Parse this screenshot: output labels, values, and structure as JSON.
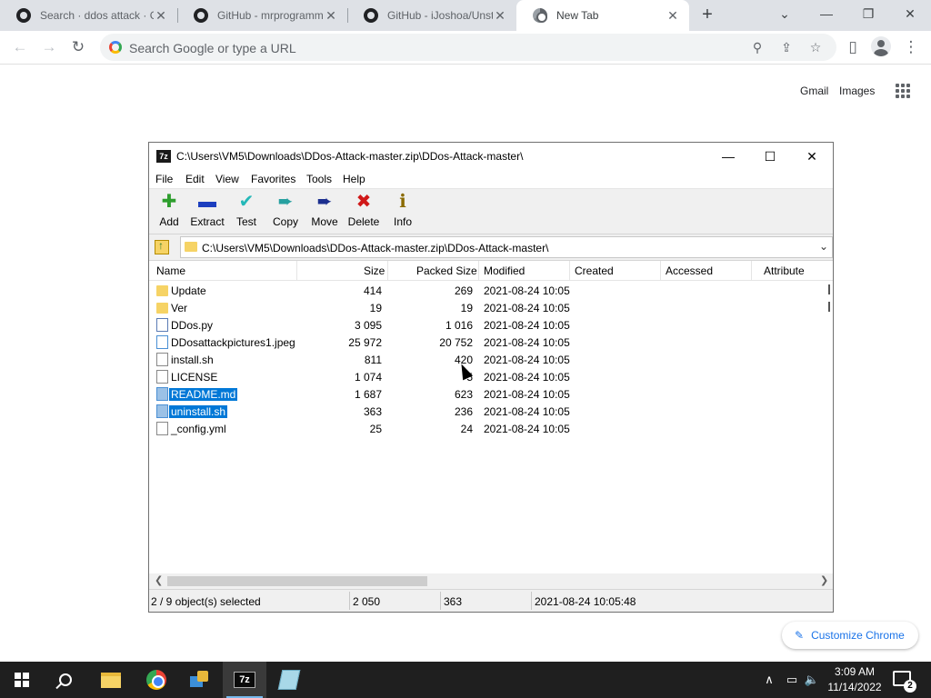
{
  "browser": {
    "tabs": [
      {
        "title": "Search · ddos attack · G",
        "icon": "github-icon"
      },
      {
        "title": "GitHub - mrprogramm",
        "icon": "github-icon"
      },
      {
        "title": "GitHub - iJoshoa/Unst",
        "icon": "github-icon"
      },
      {
        "title": "New Tab",
        "icon": "chrome-icon",
        "active": true
      }
    ],
    "new_tab": "+",
    "window_controls": {
      "dropdown": "⌄",
      "minimize": "—",
      "maximize": "❐",
      "close": "✕"
    },
    "toolbar": {
      "back": "←",
      "forward": "→",
      "reload": "↻"
    },
    "omnibox_placeholder": "Search Google or type a URL",
    "omnibox_icons": {
      "zoom": "⚲",
      "share": "⇪",
      "bookmark": "☆"
    },
    "side_panel": "▯",
    "menu": "⋮"
  },
  "ntp": {
    "gmail": "Gmail",
    "images": "Images",
    "customize": "Customize Chrome",
    "customize_icon": "✎"
  },
  "sevenzip": {
    "logo": "7z",
    "title": "C:\\Users\\VM5\\Downloads\\DDos-Attack-master.zip\\DDos-Attack-master\\",
    "controls": {
      "minimize": "—",
      "maximize": "☐",
      "close": "✕"
    },
    "menu": [
      "File",
      "Edit",
      "View",
      "Favorites",
      "Tools",
      "Help"
    ],
    "tools": [
      {
        "label": "Add",
        "glyph": "✚",
        "color": "#2e9e2e"
      },
      {
        "label": "Extract",
        "glyph": "▬",
        "color": "#1c3fbf"
      },
      {
        "label": "Test",
        "glyph": "✔",
        "color": "#24b8b8"
      },
      {
        "label": "Copy",
        "glyph": "➨",
        "color": "#26a0a0"
      },
      {
        "label": "Move",
        "glyph": "➨",
        "color": "#1c2f8f"
      },
      {
        "label": "Delete",
        "glyph": "✖",
        "color": "#d01818"
      },
      {
        "label": "Info",
        "glyph": "ℹ",
        "color": "#8a6a00"
      }
    ],
    "path": "C:\\Users\\VM5\\Downloads\\DDos-Attack-master.zip\\DDos-Attack-master\\",
    "path_dropdown": "⌄",
    "columns": [
      "Name",
      "Size",
      "Packed Size",
      "Modified",
      "Created",
      "Accessed",
      "Attribute"
    ],
    "files": [
      {
        "name": "Update",
        "size": "414",
        "packed": "269",
        "modified": "2021-08-24 10:05",
        "kind": "folder",
        "selected": false
      },
      {
        "name": "Ver",
        "size": "19",
        "packed": "19",
        "modified": "2021-08-24 10:05",
        "kind": "folder",
        "selected": false
      },
      {
        "name": "DDos.py",
        "size": "3 095",
        "packed": "1 016",
        "modified": "2021-08-24 10:05",
        "kind": "py",
        "selected": false
      },
      {
        "name": "DDosattackpictures1.jpeg",
        "size": "25 972",
        "packed": "20 752",
        "modified": "2021-08-24 10:05",
        "kind": "img",
        "selected": false
      },
      {
        "name": "install.sh",
        "size": "811",
        "packed": "420",
        "modified": "2021-08-24 10:05",
        "kind": "file",
        "selected": false
      },
      {
        "name": "LICENSE",
        "size": "1 074",
        "packed": "5",
        "modified": "2021-08-24 10:05",
        "kind": "file",
        "selected": false
      },
      {
        "name": "README.md",
        "size": "1 687",
        "packed": "623",
        "modified": "2021-08-24 10:05",
        "kind": "md",
        "selected": true
      },
      {
        "name": "uninstall.sh",
        "size": "363",
        "packed": "236",
        "modified": "2021-08-24 10:05",
        "kind": "md",
        "selected": true
      },
      {
        "name": "_config.yml",
        "size": "25",
        "packed": "24",
        "modified": "2021-08-24 10:05",
        "kind": "file",
        "selected": false
      }
    ],
    "scroll": {
      "left": "❮",
      "right": "❯"
    },
    "status": {
      "selected": "2 / 9 object(s) selected",
      "size": "2 050",
      "packed": "363",
      "modified": "2021-08-24 10:05:48"
    }
  },
  "taskbar": {
    "z7_label": "7z",
    "tray": {
      "chevron": "∧",
      "network": "▭",
      "volume": "🔈"
    },
    "time": "3:09 AM",
    "date": "11/14/2022",
    "notifications": "2"
  }
}
